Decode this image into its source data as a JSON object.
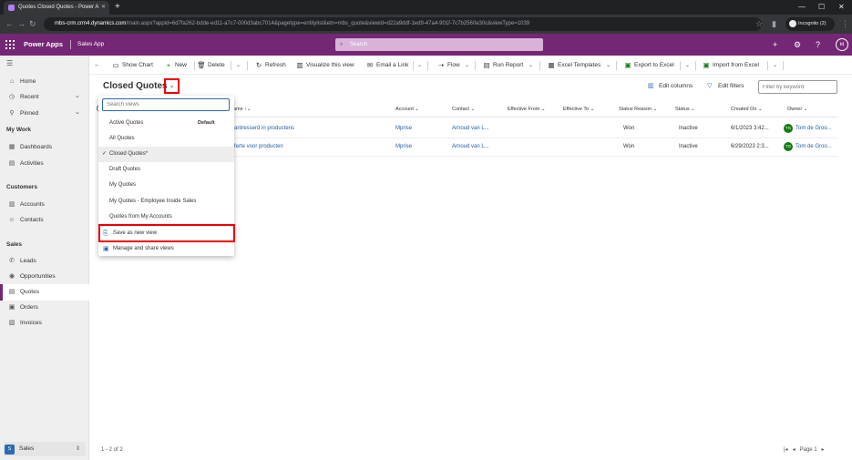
{
  "browser": {
    "tab_title": "Quotes Closed Quotes - Power A",
    "url_host": "mbs-crm.crm4.dynamics.com",
    "url_rest": "/main.aspx?appid=6d7fa262-bdde-ed11-a7c7-000d3abc7014&pagetype=entitylist&etn=mbs_quote&viewid=d22a9ddf-1ed9-47a4-901f-7c7b2560e30c&viewType=1039",
    "incognito_label": "Incognito (2)"
  },
  "app": {
    "title": "Power Apps",
    "name": "Sales App",
    "search_placeholder": "Search",
    "user_initials": "td"
  },
  "sidebar": {
    "top_items": [
      {
        "label": "Home",
        "icon": "home-icon"
      },
      {
        "label": "Recent",
        "icon": "clock-icon"
      },
      {
        "label": "Pinned",
        "icon": "pin-icon"
      }
    ],
    "sections": [
      {
        "title": "My Work",
        "items": [
          "Dashboards",
          "Activities"
        ]
      },
      {
        "title": "Customers",
        "items": [
          "Accounts",
          "Contacts"
        ]
      },
      {
        "title": "Sales",
        "items": [
          "Leads",
          "Opportunities",
          "Quotes",
          "Orders",
          "Invoices"
        ]
      }
    ],
    "active_item": "Quotes",
    "area": {
      "badge": "S",
      "label": "Sales"
    }
  },
  "command_bar": {
    "show_chart": "Show Chart",
    "new": "New",
    "delete": "Delete",
    "refresh": "Refresh",
    "visualize": "Visualize this view",
    "email_link": "Email a Link",
    "flow": "Flow",
    "run_report": "Run Report",
    "excel_templates": "Excel Templates",
    "export_excel": "Export to Excel",
    "import_excel": "Import from Excel"
  },
  "view": {
    "title": "Closed Quotes",
    "edit_columns": "Edit columns",
    "edit_filters": "Edit filters",
    "filter_placeholder": "Filter by keyword"
  },
  "grid": {
    "columns": {
      "name": "ame",
      "account": "Account",
      "contact": "Contact",
      "effective_from": "Effective From",
      "effective_to": "Effective To",
      "status_reason": "Status Reason",
      "status": "Status",
      "created_on": "Created On",
      "owner": "Owner"
    },
    "rows": [
      {
        "name": "antresserd in productens",
        "account": "Mprise",
        "contact": "Arnoud van L...",
        "status_reason": "Won",
        "status": "Inactive",
        "created_on": "6/1/2023 3:42...",
        "owner": "Tom de Groo...",
        "owner_initials": "TG"
      },
      {
        "name": "ferte voor producten",
        "account": "Mprise",
        "contact": "Arnoud van L...",
        "status_reason": "Won",
        "status": "Inactive",
        "created_on": "6/29/2023 2:3...",
        "owner": "Tom de Groo...",
        "owner_initials": "TG"
      }
    ],
    "footer_count": "1 - 2 of 2",
    "page_label": "Page 1"
  },
  "view_dropdown": {
    "search_placeholder": "Search views",
    "default_label": "Default",
    "items": [
      "Active Quotes",
      "All Quotes",
      "Closed Quotes*",
      "Draft Quotes",
      "My Quotes",
      "My Quotes - Employee Inside Sales",
      "Quotes from My Accounts"
    ],
    "selected": "Closed Quotes*",
    "save_as_new": "Save as new view",
    "manage_share": "Manage and share views"
  }
}
